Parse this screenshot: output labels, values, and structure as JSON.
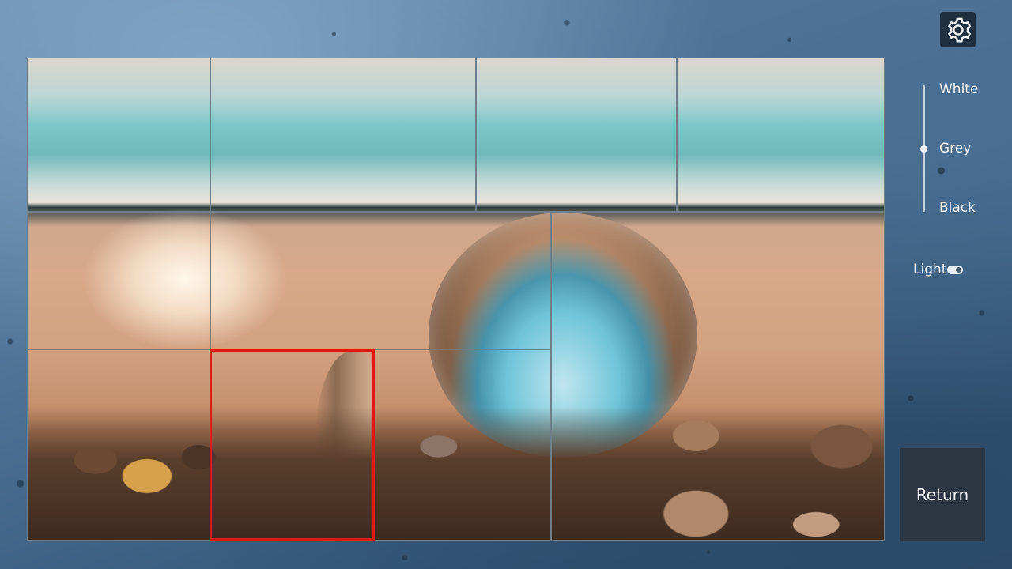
{
  "settings": {
    "icon": "gear-icon"
  },
  "background_options": {
    "items": [
      {
        "label": "White"
      },
      {
        "label": "Grey"
      },
      {
        "label": "Black"
      }
    ],
    "selected": "Grey",
    "slider_value": 0.5
  },
  "light_toggle": {
    "label": "Light",
    "on": true
  },
  "return_button": {
    "label": "Return"
  },
  "puzzle": {
    "rows": 3,
    "tiles_total": 10,
    "selected_tile_color": "#e01818"
  }
}
